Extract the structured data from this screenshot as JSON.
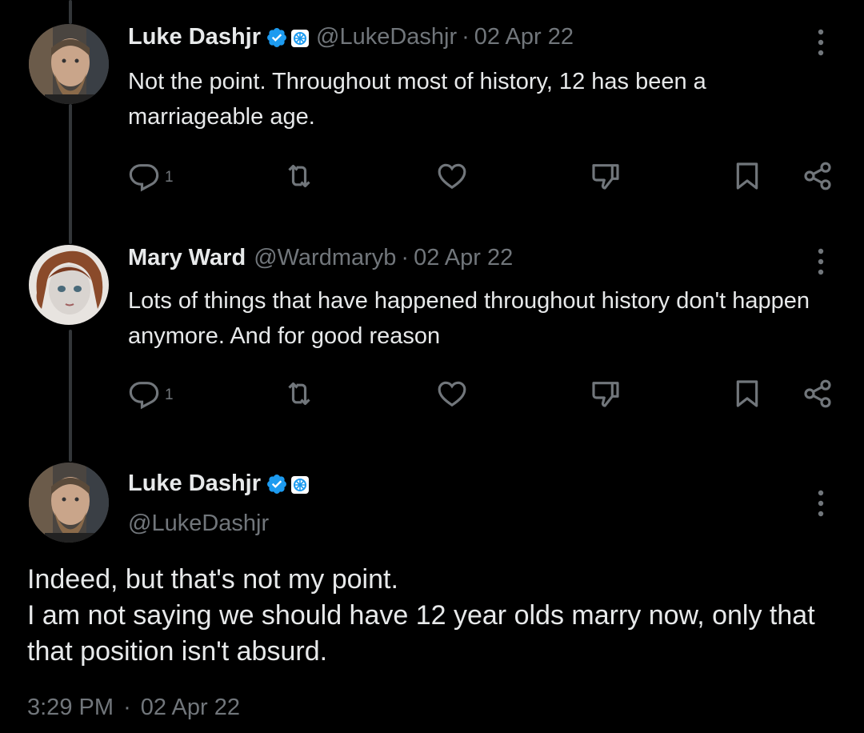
{
  "thread": [
    {
      "name": "Luke Dashjr",
      "handle": "@LukeDashjr",
      "separator": "·",
      "date": "02 Apr 22",
      "text": "Not the point. Throughout most of history, 12 has been a marriageable age.",
      "reply_count": "1",
      "verified": true,
      "affiliate_badge": true
    },
    {
      "name": "Mary Ward",
      "handle": "@Wardmaryb",
      "separator": "·",
      "date": "02 Apr 22",
      "text": "Lots of things that have happened throughout history don't happen anymore. And for good reason",
      "reply_count": "1",
      "verified": false,
      "affiliate_badge": false
    }
  ],
  "main_tweet": {
    "name": "Luke Dashjr",
    "handle": "@LukeDashjr",
    "text_line1": "Indeed, but that's not my point.",
    "text_line2": "I am not saying we should have 12 year olds marry now, only that that position isn't absurd.",
    "time": "3:29 PM",
    "separator": "·",
    "date": "02 Apr 22",
    "verified": true,
    "affiliate_badge": true
  },
  "icons": {
    "reply": "reply-icon",
    "retweet": "retweet-icon",
    "like": "heart-icon",
    "dislike": "thumbs-down-icon",
    "bookmark": "bookmark-icon",
    "share": "share-icon",
    "more": "more-vertical-icon",
    "verified": "verified-badge-icon",
    "affiliate": "affiliate-badge-icon"
  },
  "colors": {
    "background": "#000000",
    "text_primary": "#e7e9ea",
    "text_secondary": "#71767b",
    "verified_blue": "#1d9bf0",
    "thread_line": "#333639"
  }
}
